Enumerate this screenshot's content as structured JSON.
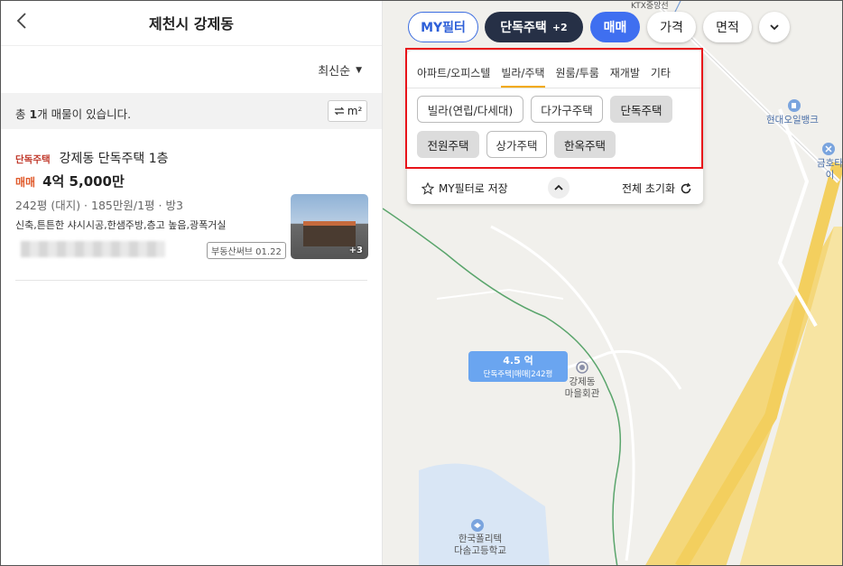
{
  "header": {
    "title": "제천시 강제동"
  },
  "sort": {
    "label": "최신순"
  },
  "summary": {
    "prefix": "총 ",
    "count": "1",
    "suffix": "개 매물이 있습니다.",
    "unit_label": "m²"
  },
  "listing": {
    "type_tag": "단독주택",
    "title": "강제동 단독주택 1층",
    "deal_type": "매매",
    "price": "4억 5,000만",
    "specs": "242평 (대지) · 185만원/1평 · 방3",
    "description": "신축,튼튼한 샤시시공,한샘주방,층고 높음,광폭거실",
    "source": "부동산써브 01.22",
    "photo_count": "+3"
  },
  "filters": {
    "my_filter": "MY필터",
    "property_type": "단독주택",
    "property_type_count": "+2",
    "deal": "매매",
    "price": "가격",
    "area": "면적"
  },
  "panel": {
    "tabs": [
      "아파트/오피스텔",
      "빌라/주택",
      "원룸/투룸",
      "재개발",
      "기타"
    ],
    "active_tab": 1,
    "options": [
      {
        "label": "빌라(연립/다세대)",
        "selected": false
      },
      {
        "label": "다가구주택",
        "selected": false
      },
      {
        "label": "단독주택",
        "selected": true
      },
      {
        "label": "전원주택",
        "selected": true
      },
      {
        "label": "상가주택",
        "selected": false
      },
      {
        "label": "한옥주택",
        "selected": true
      }
    ],
    "save_label": "MY필터로 저장",
    "reset_label": "전체 초기화"
  },
  "map": {
    "marker": {
      "price": "4.5 억",
      "detail": "단독주택|매매|242평"
    },
    "labels": {
      "rail": "KTX중앙선",
      "bank": "현대오일뱅크",
      "tire": "금호타이",
      "hall_1": "강제동",
      "hall_2": "마을회관",
      "school_1": "한국폴리텍",
      "school_2": "다솜고등학교"
    }
  },
  "colors": {
    "accent": "#3f6ff0",
    "dark": "#263046",
    "highlight": "#e8141a",
    "deal": "#e05a2b"
  }
}
